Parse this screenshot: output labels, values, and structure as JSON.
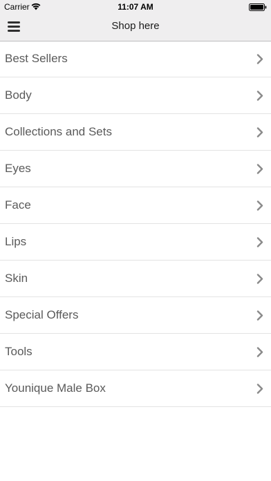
{
  "status_bar": {
    "carrier": "Carrier",
    "time": "11:07 AM",
    "icons": [
      "wifi-icon",
      "battery-icon"
    ]
  },
  "nav_bar": {
    "title": "Shop here",
    "menu_icon": "hamburger-menu-icon"
  },
  "categories": [
    {
      "label": "Best Sellers"
    },
    {
      "label": "Body"
    },
    {
      "label": "Collections and Sets"
    },
    {
      "label": "Eyes"
    },
    {
      "label": "Face"
    },
    {
      "label": "Lips"
    },
    {
      "label": "Skin"
    },
    {
      "label": "Special Offers"
    },
    {
      "label": "Tools"
    },
    {
      "label": "Younique Male Box"
    }
  ],
  "colors": {
    "header_background": "#efeeef",
    "item_text": "#5a5a5a",
    "chevron": "#8a8a8a",
    "separator": "#e3e3e3"
  }
}
